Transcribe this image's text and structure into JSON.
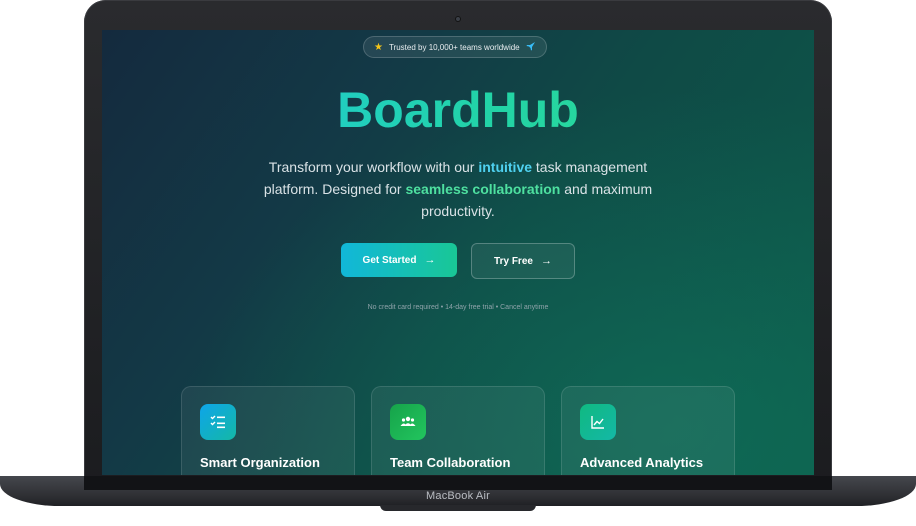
{
  "device": {
    "label": "MacBook Air"
  },
  "badge": {
    "icon_left": "star-icon",
    "text": "Trusted by 10,000+ teams worldwide",
    "icon_right": "rocket-icon"
  },
  "hero": {
    "title": "BoardHub",
    "desc_part1": "Transform your workflow with our ",
    "desc_highlight1": "intuitive",
    "desc_part2": " task management platform. Designed for ",
    "desc_highlight2": "seamless collaboration",
    "desc_part3": " and maximum productivity."
  },
  "actions": {
    "primary_label": "Get Started",
    "secondary_label": "Try Free",
    "arrow_icon": "arrow-right-icon"
  },
  "fine_print": "No credit card required • 14-day free trial • Cancel anytime",
  "features": [
    {
      "title": "Smart Organization",
      "icon": "checklist-icon",
      "color": "#0ea5e9"
    },
    {
      "title": "Team Collaboration",
      "icon": "team-icon",
      "color": "#16a34a"
    },
    {
      "title": "Advanced Analytics",
      "icon": "analytics-icon",
      "color": "#10b981"
    }
  ],
  "colors": {
    "accent_blue": "#1fc8e6",
    "accent_green": "#22d3a6",
    "background": "#0f4a46"
  }
}
